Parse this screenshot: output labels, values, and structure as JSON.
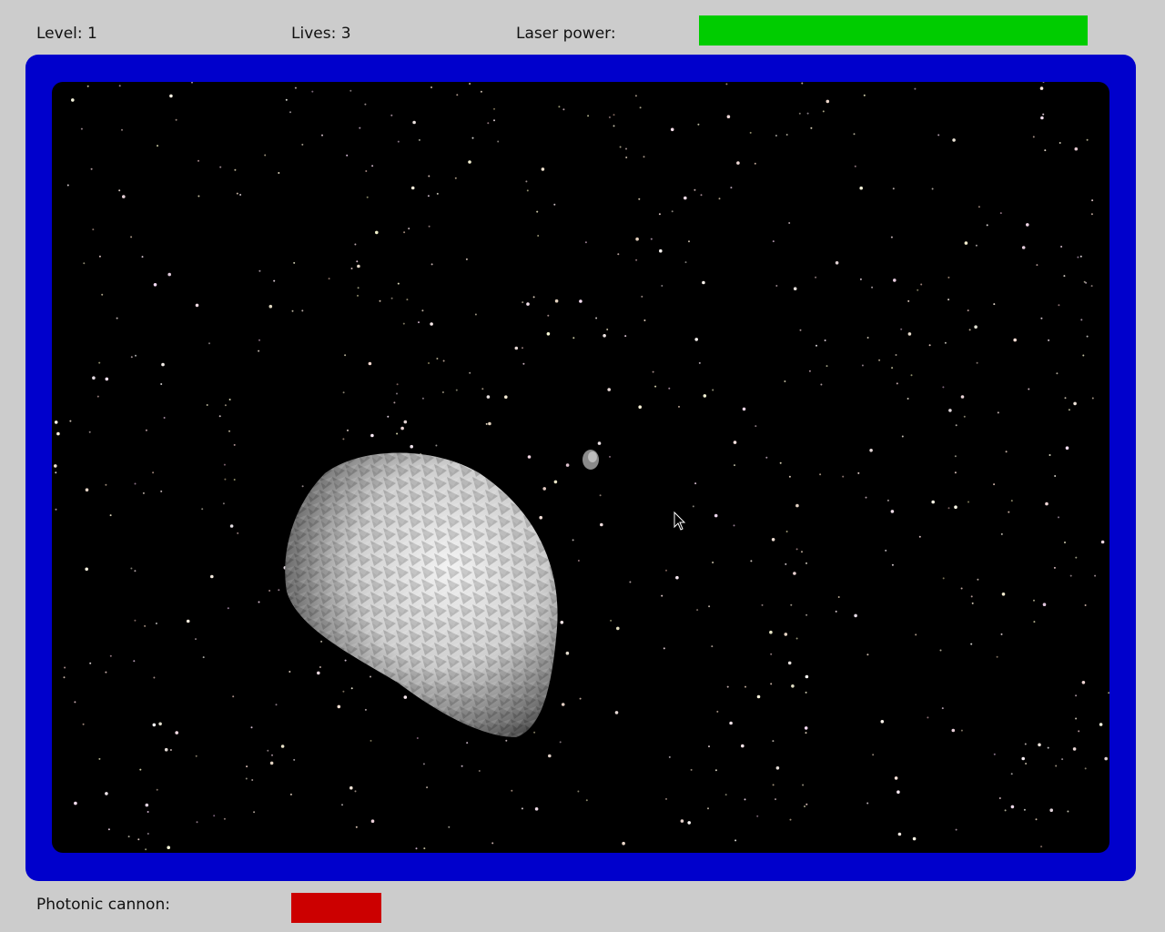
{
  "hud": {
    "level_label": "Level: 1",
    "lives_label": "Lives: 3",
    "laser_label": "Laser power:",
    "laser_power": 1.0,
    "laser_color": "#00cc00",
    "cannon_label": "Photonic cannon:",
    "cannon_charge": 1.0,
    "cannon_color": "#cc0000"
  },
  "colors": {
    "frame": "#0000cc",
    "background": "#cccccc",
    "space": "#000000"
  }
}
